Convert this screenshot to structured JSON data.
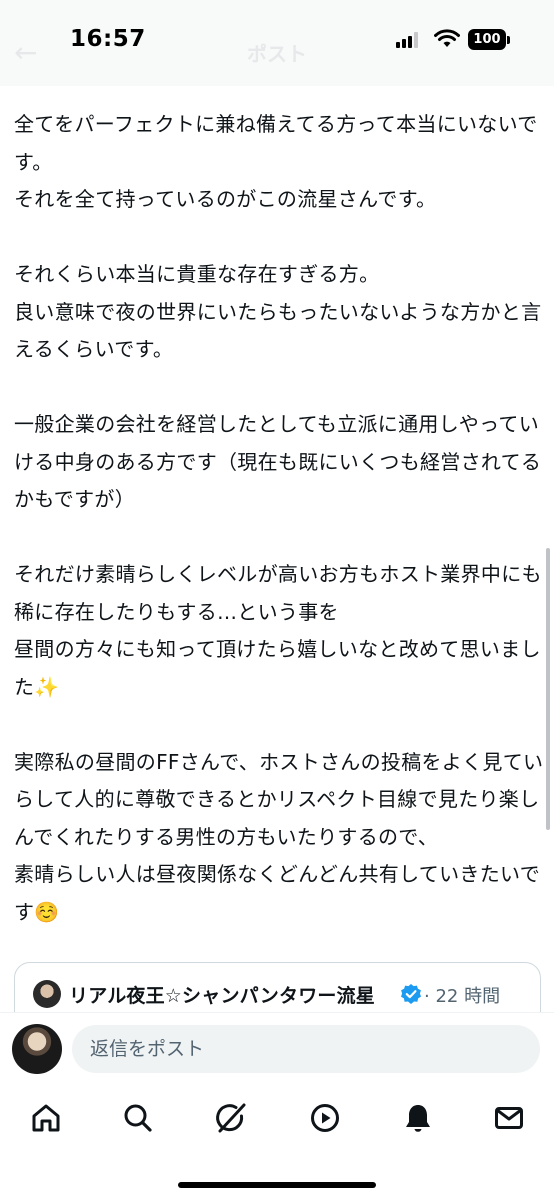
{
  "status_bar": {
    "time": "16:57",
    "battery": "100"
  },
  "header": {
    "back_icon": "back-arrow-icon",
    "title": "ポスト"
  },
  "post": {
    "text": "全てをパーフェクトに兼ね備えてる方って本当にいないです。\nそれを全て持っているのがこの流星さんです。\n\nそれくらい本当に貴重な存在すぎる方。\n良い意味で夜の世界にいたらもったいないような方かと言えるくらいです。\n\n一般企業の会社を経営したとしても立派に通用しやっていける中身のある方です（現在も既にいくつも経営されてるかもですが）\n\nそれだけ素晴らしくレベルが高いお方もホスト業界中にも稀に存在したりもする…という事を\n昼間の方々にも知って頂けたら嬉しいなと改めて思いました✨\n\n実際私の昼間のFFさんで、ホストさんの投稿をよく見ていらして人的に尊敬できるとかリスペクト目線で見たり楽しんでくれたりする男性の方もいたりするので、\n素晴らしい人は昼夜関係なくどんどん共有していきたいです☺️"
  },
  "quote": {
    "author_name": "リアル夜王☆シャンパンタワー流星",
    "time": "· 22 時間",
    "verified_icon": "verified-badge-icon"
  },
  "reply": {
    "placeholder": "返信をポスト"
  },
  "tabs": [
    {
      "name": "home",
      "icon": "home-icon"
    },
    {
      "name": "search",
      "icon": "search-icon"
    },
    {
      "name": "grok",
      "icon": "grok-icon"
    },
    {
      "name": "video",
      "icon": "play-icon"
    },
    {
      "name": "notifications",
      "icon": "bell-icon"
    },
    {
      "name": "messages",
      "icon": "envelope-icon"
    }
  ],
  "colors": {
    "text": "#0f1419",
    "secondary_text": "#536471",
    "verified_blue": "#1d9bf0",
    "input_bg": "#eff3f4"
  }
}
